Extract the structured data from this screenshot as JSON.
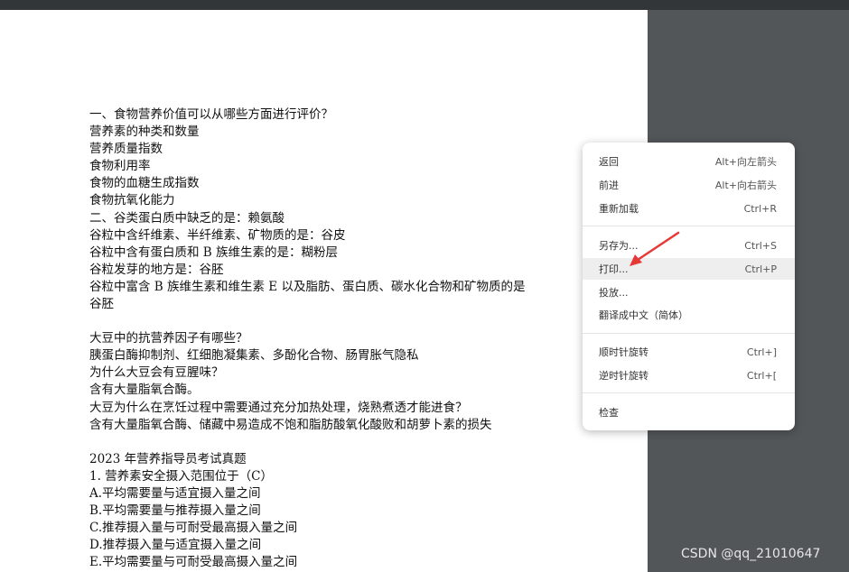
{
  "document": {
    "lines": [
      "一、食物营养价值可以从哪些方面进行评价？",
      "营养素的种类和数量",
      "营养质量指数",
      "食物利用率",
      "食物的血糖生成指数",
      "食物抗氧化能力",
      "二、谷类蛋白质中缺乏的是：赖氨酸",
      "谷粒中含纤维素、半纤维素、矿物质的是：谷皮",
      "谷粒中含有蛋白质和 B 族维生素的是：糊粉层",
      "谷粒发芽的地方是：谷胚",
      "谷粒中富含 B 族维生素和维生素 E 以及脂肪、蛋白质、碳水化合物和矿物质的是",
      "谷胚",
      "",
      "大豆中的抗营养因子有哪些？",
      "胰蛋白酶抑制剂、红细胞凝集素、多酚化合物、肠胃胀气隐私",
      "为什么大豆会有豆腥味？",
      "含有大量脂氧合酶。",
      "大豆为什么在烹饪过程中需要通过充分加热处理，烧熟煮透才能进食？",
      "含有大量脂氧合酶、储藏中易造成不饱和脂肪酸氧化酸败和胡萝卜素的损失",
      "",
      " 2023 年营养指导员考试真题",
      "1. 营养素安全摄入范围位于（C）",
      "A.平均需要量与适宜摄入量之间",
      "B.平均需要量与推荐摄入量之间",
      "C.推荐摄入量与可耐受最高摄入量之间",
      "D.推荐摄入量与适宜摄入量之间",
      "E.平均需要量与可耐受最高摄入量之间"
    ]
  },
  "context_menu": {
    "back": {
      "label": "返回",
      "shortcut": "Alt+向左箭头"
    },
    "forward": {
      "label": "前进",
      "shortcut": "Alt+向右箭头"
    },
    "reload": {
      "label": "重新加载",
      "shortcut": "Ctrl+R"
    },
    "save_as": {
      "label": "另存为...",
      "shortcut": "Ctrl+S"
    },
    "print": {
      "label": "打印...",
      "shortcut": "Ctrl+P"
    },
    "cast": {
      "label": "投放...",
      "shortcut": ""
    },
    "translate": {
      "label": "翻译成中文（简体）",
      "shortcut": ""
    },
    "rotate_cw": {
      "label": "顺时针旋转",
      "shortcut": "Ctrl+]"
    },
    "rotate_ccw": {
      "label": "逆时针旋转",
      "shortcut": "Ctrl+["
    },
    "inspect": {
      "label": "检查",
      "shortcut": ""
    }
  },
  "annotation": {
    "arrow_color": "#e53935"
  },
  "watermark": {
    "text": "CSDN @qq_21010647"
  }
}
